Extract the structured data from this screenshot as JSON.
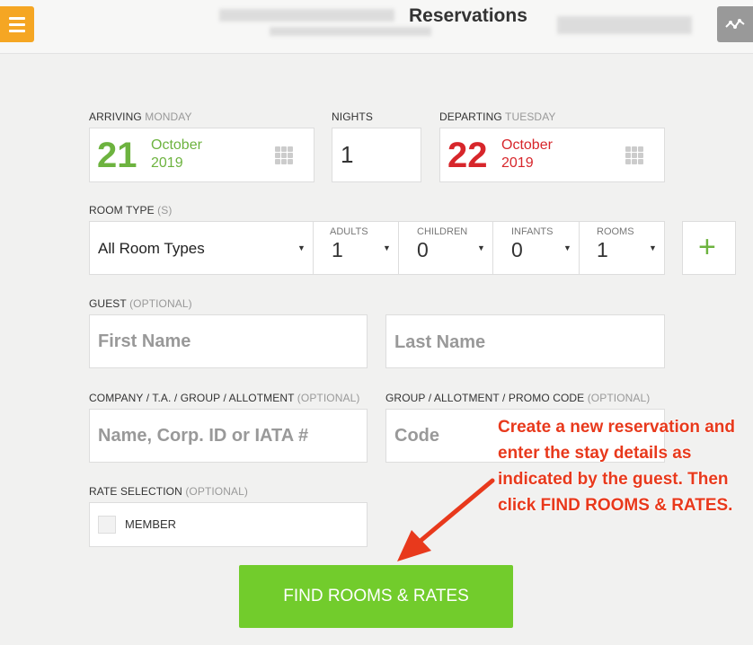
{
  "header": {
    "title": "Reservations"
  },
  "arriving": {
    "label": "ARRIVING",
    "weekday": "MONDAY",
    "day": "21",
    "month": "October",
    "year": "2019"
  },
  "nights": {
    "label": "NIGHTS",
    "value": "1"
  },
  "departing": {
    "label": "DEPARTING",
    "weekday": "TUESDAY",
    "day": "22",
    "month": "October",
    "year": "2019"
  },
  "room_type": {
    "label": "ROOM TYPE",
    "label_suffix": "(S)",
    "selected": "All Room Types",
    "adults_label": "ADULTS",
    "adults": "1",
    "children_label": "CHILDREN",
    "children": "0",
    "infants_label": "INFANTS",
    "infants": "0",
    "rooms_label": "ROOMS",
    "rooms": "1",
    "add_symbol": "+"
  },
  "guest": {
    "label": "GUEST",
    "optional": "(OPTIONAL)",
    "first_name_placeholder": "First Name",
    "last_name_placeholder": "Last Name"
  },
  "company": {
    "label": "COMPANY / T.A. / GROUP / ALLOTMENT",
    "optional": "(OPTIONAL)",
    "placeholder": "Name, Corp. ID or IATA #"
  },
  "promo": {
    "label": "GROUP / ALLOTMENT / PROMO CODE",
    "optional": "(OPTIONAL)",
    "placeholder": "Code"
  },
  "rate_selection": {
    "label": "RATE SELECTION",
    "optional": "(OPTIONAL)",
    "member_label": "MEMBER"
  },
  "find_button": "FIND ROOMS & RATES",
  "annotation": "Create a new reservation and enter the stay details as indicated by the guest. Then click FIND ROOMS & RATES.",
  "colors": {
    "accent_orange": "#f5a623",
    "arrive_green": "#6db33f",
    "depart_red": "#d7262b",
    "button_green": "#72cc2c",
    "annotation_red": "#e8391c"
  }
}
